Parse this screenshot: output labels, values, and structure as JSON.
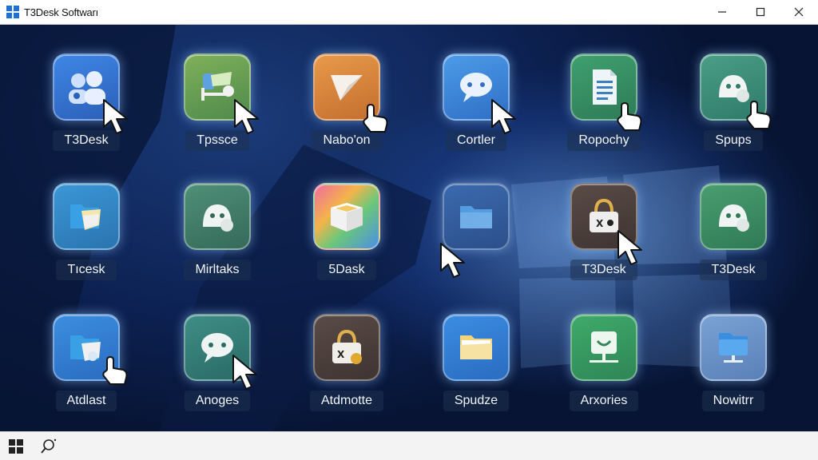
{
  "window": {
    "title": "T3Desk Softwarı"
  },
  "icons": [
    {
      "label": "T3Desk",
      "icon": "users-icon"
    },
    {
      "label": "Tpssce",
      "icon": "share-icon"
    },
    {
      "label": "Nabo'on",
      "icon": "send-icon"
    },
    {
      "label": "Cortler",
      "icon": "chat-icon"
    },
    {
      "label": "Ropochy",
      "icon": "document-icon"
    },
    {
      "label": "Spups",
      "icon": "remote-icon"
    },
    {
      "label": "Tıcesk",
      "icon": "folder-share-icon"
    },
    {
      "label": "Mirltaks",
      "icon": "remote-icon"
    },
    {
      "label": "5Dask",
      "icon": "box-icon"
    },
    {
      "label": "",
      "icon": "folder-icon"
    },
    {
      "label": "T3Desk",
      "icon": "lock-icon"
    },
    {
      "label": "T3Desk",
      "icon": "remote-icon"
    },
    {
      "label": "Atdlast",
      "icon": "folder-share-icon"
    },
    {
      "label": "Anoges",
      "icon": "chat-icon"
    },
    {
      "label": "Atdmotte",
      "icon": "lock-icon"
    },
    {
      "label": "Spudze",
      "icon": "folder-icon"
    },
    {
      "label": "Arxories",
      "icon": "monitor-icon"
    },
    {
      "label": "Nowitrr",
      "icon": "folder-monitor-icon"
    }
  ],
  "taskbar": {
    "start": "windows-start-icon",
    "search": "search-icon"
  }
}
